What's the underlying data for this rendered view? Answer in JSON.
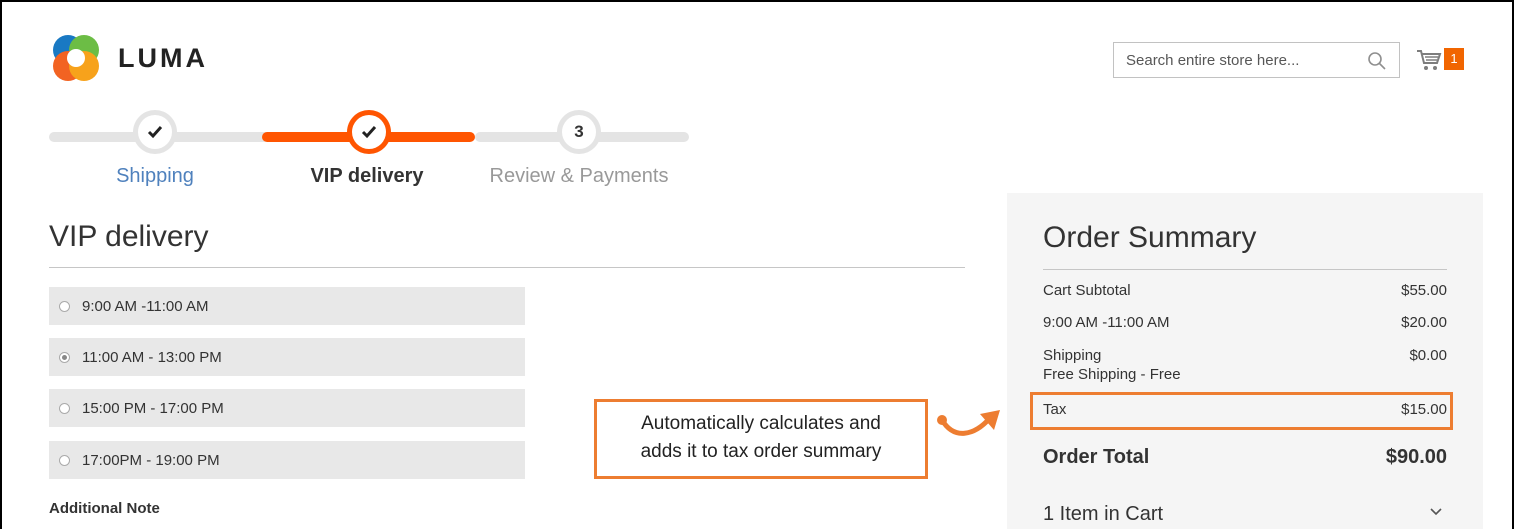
{
  "header": {
    "logo_text": "LUMA",
    "search_placeholder": "Search entire store here...",
    "cart_count": "1"
  },
  "progress": {
    "steps": [
      {
        "label": "Shipping",
        "state": "complete",
        "marker": ""
      },
      {
        "label": "VIP delivery",
        "state": "active",
        "marker": ""
      },
      {
        "label": "Review & Payments",
        "state": "pending",
        "marker": "3"
      }
    ]
  },
  "delivery": {
    "title": "VIP delivery",
    "options": [
      {
        "label": "9:00 AM -11:00 AM",
        "checked": false
      },
      {
        "label": "11:00 AM - 13:00 PM",
        "checked": true
      },
      {
        "label": "15:00 PM - 17:00 PM",
        "checked": false
      },
      {
        "label": "17:00PM - 19:00 PM",
        "checked": false
      }
    ],
    "note_label": "Additional Note"
  },
  "annotation": {
    "line1": "Automatically calculates and",
    "line2": "adds it to tax order summary"
  },
  "summary": {
    "title": "Order Summary",
    "rows": [
      {
        "label": "Cart Subtotal",
        "value": "$55.00"
      },
      {
        "label": "9:00 AM -11:00 AM",
        "value": "$20.00"
      },
      {
        "label": "Shipping",
        "sub": "Free Shipping - Free",
        "value": "$0.00"
      },
      {
        "label": "Tax",
        "value": "$15.00"
      }
    ],
    "total_label": "Order Total",
    "total_value": "$90.00",
    "items_label": "1 Item in Cart"
  },
  "colors": {
    "accent": "#ff5501",
    "annotation": "#ed7d31",
    "link_blue": "#4f81bd"
  }
}
